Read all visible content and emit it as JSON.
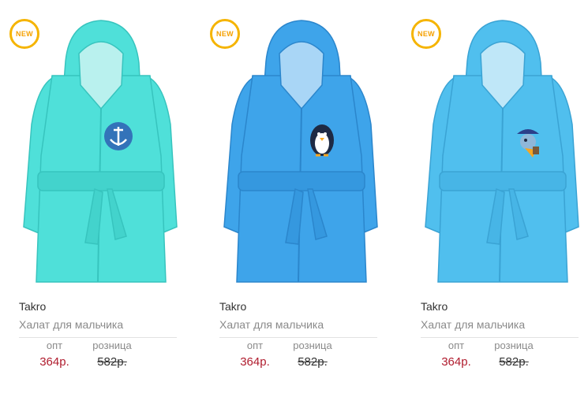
{
  "products": [
    {
      "badge": "NEW",
      "brand": "Takro",
      "title": "Халат для мальчика",
      "opt_label": "опт",
      "opt_price": "364р.",
      "retail_label": "розница",
      "retail_price": "582р.",
      "color": "#4fe0d9",
      "motif": "anchor-icon"
    },
    {
      "badge": "NEW",
      "brand": "Takro",
      "title": "Халат для мальчика",
      "opt_label": "опт",
      "opt_price": "364р.",
      "retail_label": "розница",
      "retail_price": "582р.",
      "color": "#3ea4ea",
      "motif": "penguin-icon"
    },
    {
      "badge": "NEW",
      "brand": "Takro",
      "title": "Халат для мальчика",
      "opt_label": "опт",
      "opt_price": "364р.",
      "retail_label": "розница",
      "retail_price": "582р.",
      "color": "#50bfee",
      "motif": "pirate-bird-icon"
    }
  ],
  "colors": {
    "badge_border": "#f5b400",
    "opt_price": "#b01c2e",
    "muted_text": "#8a8a8a"
  }
}
